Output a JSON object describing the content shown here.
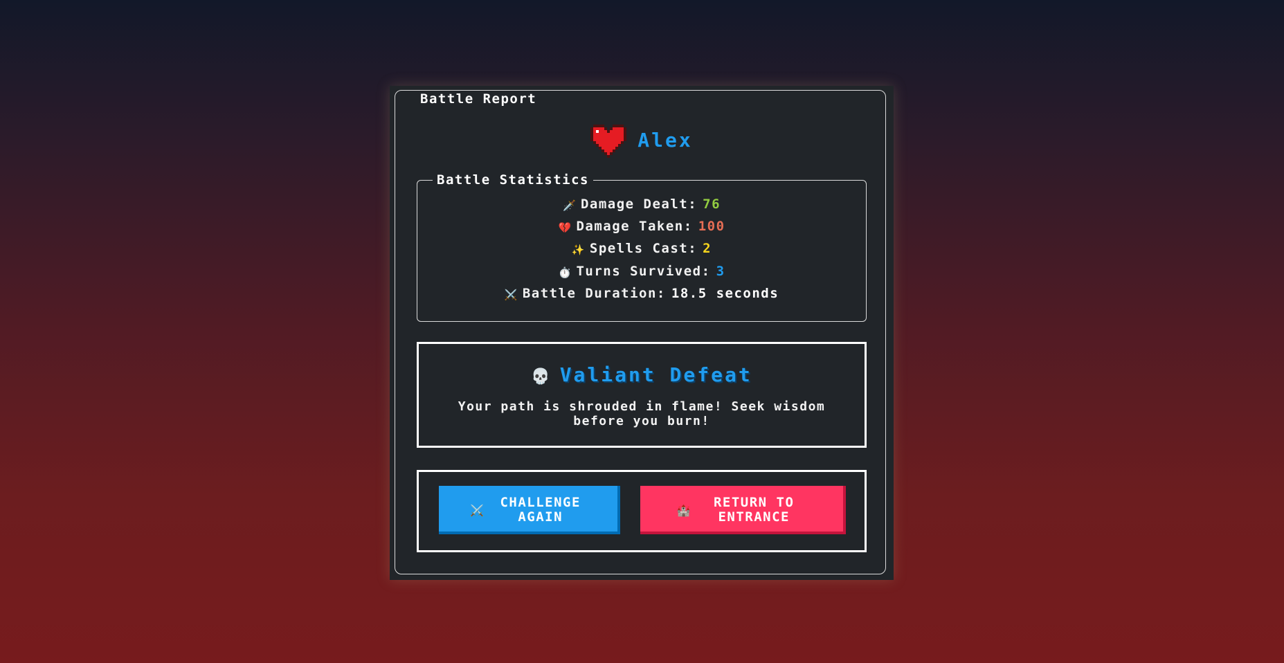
{
  "report": {
    "title": "Battle Report",
    "player": {
      "icon": "heart-icon",
      "name": "Alex"
    }
  },
  "stats": {
    "legend": "Battle Statistics",
    "items": [
      {
        "icon": "dagger-icon",
        "glyph": "🗡️",
        "label": "Damage Dealt:",
        "value": "76",
        "color": "#92cc41"
      },
      {
        "icon": "broken-heart-icon",
        "glyph": "💔",
        "label": "Damage Taken:",
        "value": "100",
        "color": "#e76e55"
      },
      {
        "icon": "sparkles-icon",
        "glyph": "✨",
        "label": "Spells Cast:",
        "value": "2",
        "color": "#f7d51d"
      },
      {
        "icon": "stopwatch-icon",
        "glyph": "⏱️",
        "label": "Turns Survived:",
        "value": "3",
        "color": "#209cee"
      },
      {
        "icon": "crossed-swords-icon",
        "glyph": "⚔️",
        "label": "Battle Duration:",
        "value": "18.5 seconds",
        "color": "#ffffff"
      }
    ]
  },
  "outcome": {
    "icon": "skull-icon",
    "glyph": "💀",
    "title": "Valiant Defeat",
    "message": "Your path is shrouded in flame! Seek wisdom before you burn!"
  },
  "actions": {
    "challenge": {
      "icon": "crossed-swords-icon",
      "glyph": "⚔️",
      "label": "CHALLENGE AGAIN"
    },
    "return": {
      "icon": "castle-icon",
      "glyph": "🏰",
      "label": "RETURN TO ENTRANCE"
    }
  },
  "colors": {
    "accent_blue": "#209cee",
    "danger_red": "#ff3561",
    "panel": "#212529"
  }
}
